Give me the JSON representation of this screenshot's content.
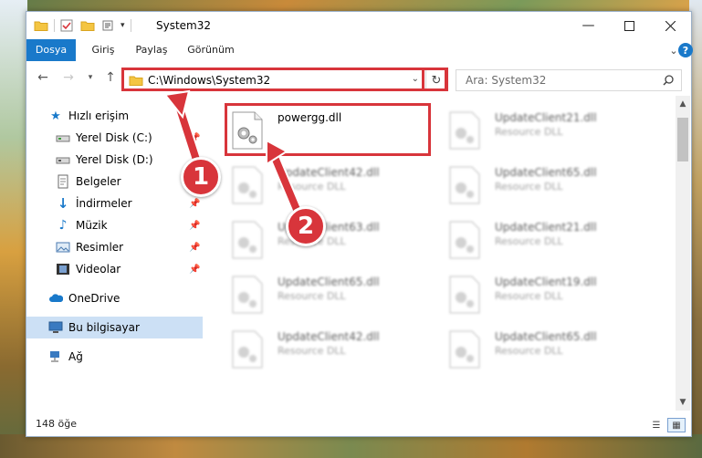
{
  "window": {
    "title": "System32"
  },
  "ribbon": {
    "tabs": [
      "Dosya",
      "Giriş",
      "Paylaş",
      "Görünüm"
    ]
  },
  "address": {
    "path": "C:\\Windows\\System32"
  },
  "search": {
    "placeholder": "Ara: System32"
  },
  "sidebar": {
    "items": [
      {
        "label": "Hızlı erişim",
        "icon": "star-icon"
      },
      {
        "label": "Yerel Disk (C:)",
        "icon": "drive-icon",
        "pinned": true
      },
      {
        "label": "Yerel Disk (D:)",
        "icon": "drive-icon"
      },
      {
        "label": "Belgeler",
        "icon": "documents-icon",
        "pinned": true
      },
      {
        "label": "İndirmeler",
        "icon": "download-icon",
        "pinned": true
      },
      {
        "label": "Müzik",
        "icon": "music-icon",
        "pinned": true
      },
      {
        "label": "Resimler",
        "icon": "pictures-icon",
        "pinned": true
      },
      {
        "label": "Videolar",
        "icon": "videos-icon",
        "pinned": true
      },
      {
        "label": "OneDrive",
        "icon": "cloud-icon"
      },
      {
        "label": "Bu bilgisayar",
        "icon": "computer-icon",
        "selected": true
      },
      {
        "label": "Ağ",
        "icon": "network-icon"
      }
    ]
  },
  "files": [
    {
      "name": "powergg.dll",
      "type": ""
    },
    {
      "name": "UpdateClient21.dll",
      "type": "Resource DLL"
    },
    {
      "name": "UpdateClient42.dll",
      "type": "Resource DLL"
    },
    {
      "name": "UpdateClient65.dll",
      "type": "Resource DLL"
    },
    {
      "name": "UpdateClient63.dll",
      "type": "Resource DLL"
    },
    {
      "name": "UpdateClient21.dll",
      "type": "Resource DLL"
    },
    {
      "name": "UpdateClient65.dll",
      "type": "Resource DLL"
    },
    {
      "name": "UpdateClient19.dll",
      "type": "Resource DLL"
    },
    {
      "name": "UpdateClient42.dll",
      "type": "Resource DLL"
    },
    {
      "name": "UpdateClient65.dll",
      "type": "Resource DLL"
    }
  ],
  "status": {
    "count": "148 öğe"
  },
  "callouts": [
    "1",
    "2"
  ],
  "colors": {
    "accent": "#1979ca",
    "highlight": "#d8353b",
    "selected": "#cce0f5"
  }
}
